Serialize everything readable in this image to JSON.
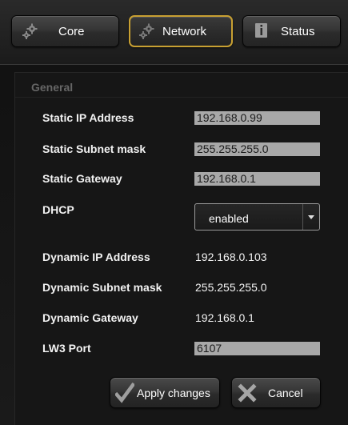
{
  "tabs": {
    "core": {
      "label": "Core",
      "icon": "gear-icon"
    },
    "network": {
      "label": "Network",
      "icon": "gear-icon",
      "active": true,
      "accent": "#c8a032"
    },
    "status": {
      "label": "Status",
      "icon": "info-icon"
    }
  },
  "general": {
    "title": "General",
    "static_ip": {
      "label": "Static IP Address",
      "value": "192.168.0.99"
    },
    "static_subnet": {
      "label": "Static Subnet mask",
      "value": "255.255.255.0"
    },
    "static_gateway": {
      "label": "Static Gateway",
      "value": "192.168.0.1"
    },
    "dhcp": {
      "label": "DHCP",
      "value": "enabled"
    },
    "dynamic_ip": {
      "label": "Dynamic IP Address",
      "value": "192.168.0.103"
    },
    "dynamic_subnet": {
      "label": "Dynamic Subnet mask",
      "value": "255.255.255.0"
    },
    "dynamic_gateway": {
      "label": "Dynamic Gateway",
      "value": "192.168.0.1"
    },
    "lw3_port": {
      "label": "LW3 Port",
      "value": "6107"
    }
  },
  "actions": {
    "apply_label": "Apply changes",
    "apply_icon": "checkmark-icon",
    "cancel_label": "Cancel",
    "cancel_icon": "close-icon"
  }
}
